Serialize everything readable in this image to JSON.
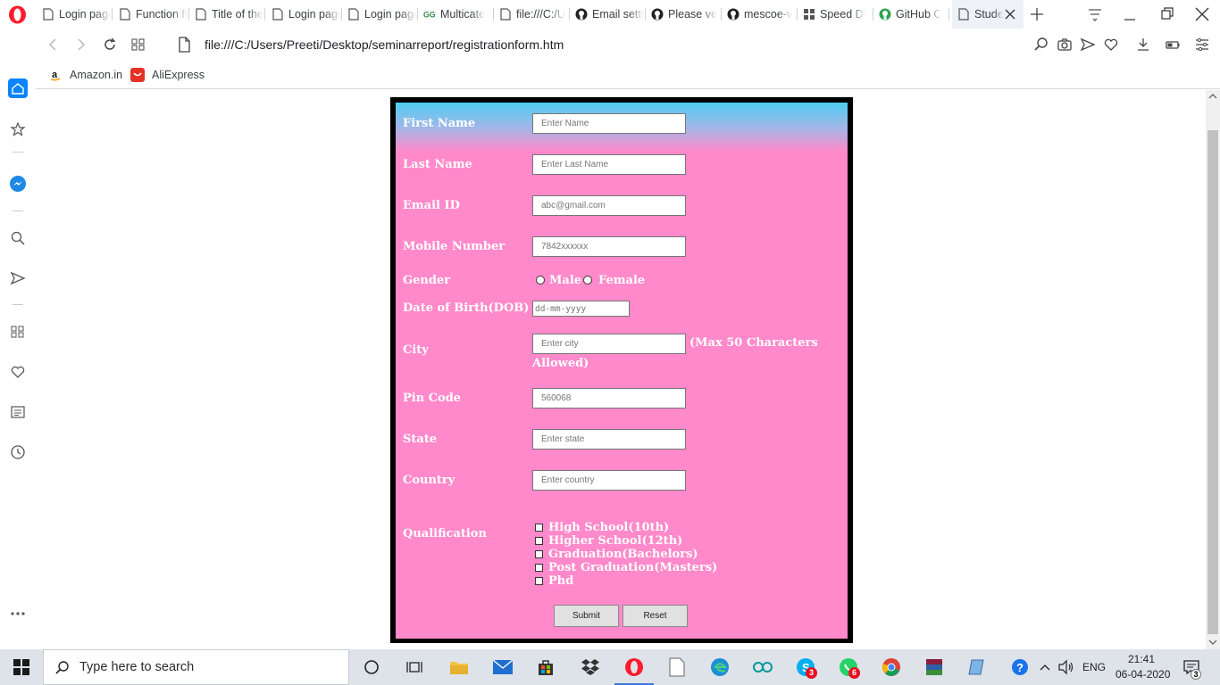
{
  "browser": {
    "tabs": [
      {
        "label": "Login page",
        "icon": "doc-icon"
      },
      {
        "label": "Function fundamentals",
        "icon": "doc-icon"
      },
      {
        "label": "Title of the",
        "icon": "doc-icon"
      },
      {
        "label": "Login page",
        "icon": "doc-icon"
      },
      {
        "label": "Login page",
        "icon": "doc-icon"
      },
      {
        "label": "Multicate",
        "icon": "gfg-icon"
      },
      {
        "label": "file:///C:/U",
        "icon": "file-icon"
      },
      {
        "label": "Email setti",
        "icon": "github-icon"
      },
      {
        "label": "Please ve",
        "icon": "github-icon"
      },
      {
        "label": "mescoe-v",
        "icon": "github-icon"
      },
      {
        "label": "Speed Di",
        "icon": "speed-dial-icon"
      },
      {
        "label": "GitHub C",
        "icon": "github-green-icon"
      },
      {
        "label": "Stude",
        "icon": "doc-icon"
      }
    ],
    "url": "file:///C:/Users/Preeti/Desktop/seminarreport/registrationform.htm",
    "bookmarks": [
      {
        "label": "Amazon.in",
        "icon": "amazon-icon"
      },
      {
        "label": "AliExpress",
        "icon": "aliexpress-icon"
      }
    ],
    "accent_color": "#0a84ff"
  },
  "form": {
    "first_name": {
      "label": "First Name",
      "placeholder": "Enter Name"
    },
    "last_name": {
      "label": "Last Name",
      "placeholder": "Enter Last Name"
    },
    "email": {
      "label": "Email ID",
      "placeholder": "abc@gmail.com"
    },
    "mobile": {
      "label": "Mobile Number",
      "placeholder": "7842xxxxxx"
    },
    "gender": {
      "label": "Gender",
      "male": "Male",
      "female": "Female"
    },
    "dob": {
      "label": "Date of Birth(DOB)",
      "placeholder": "dd-mm-yyyy"
    },
    "city": {
      "label": "City",
      "placeholder": "Enter city",
      "note_part1": "(Max 50 Characters",
      "note_part2": "Allowed)"
    },
    "pin": {
      "label": "Pin Code",
      "placeholder": "560068"
    },
    "state": {
      "label": "State",
      "placeholder": "Enter state"
    },
    "country": {
      "label": "Country",
      "placeholder": "Enter country"
    },
    "qualification": {
      "label": "Qualification",
      "options": [
        "High School(10th)",
        "Higher School(12th)",
        "Graduation(Bachelors)",
        "Post Graduation(Masters)",
        "Phd"
      ]
    },
    "submit_label": "Submit",
    "reset_label": "Reset",
    "colors": {
      "top": "#4fcdf3",
      "body": "#ff89ca",
      "frame": "#000000"
    }
  },
  "taskbar": {
    "search_placeholder": "Type here to search",
    "language": "ENG",
    "time": "21:41",
    "date": "06-04-2020",
    "skype_badge": "3",
    "whatsapp_badge": "6",
    "notification_count": "3"
  }
}
